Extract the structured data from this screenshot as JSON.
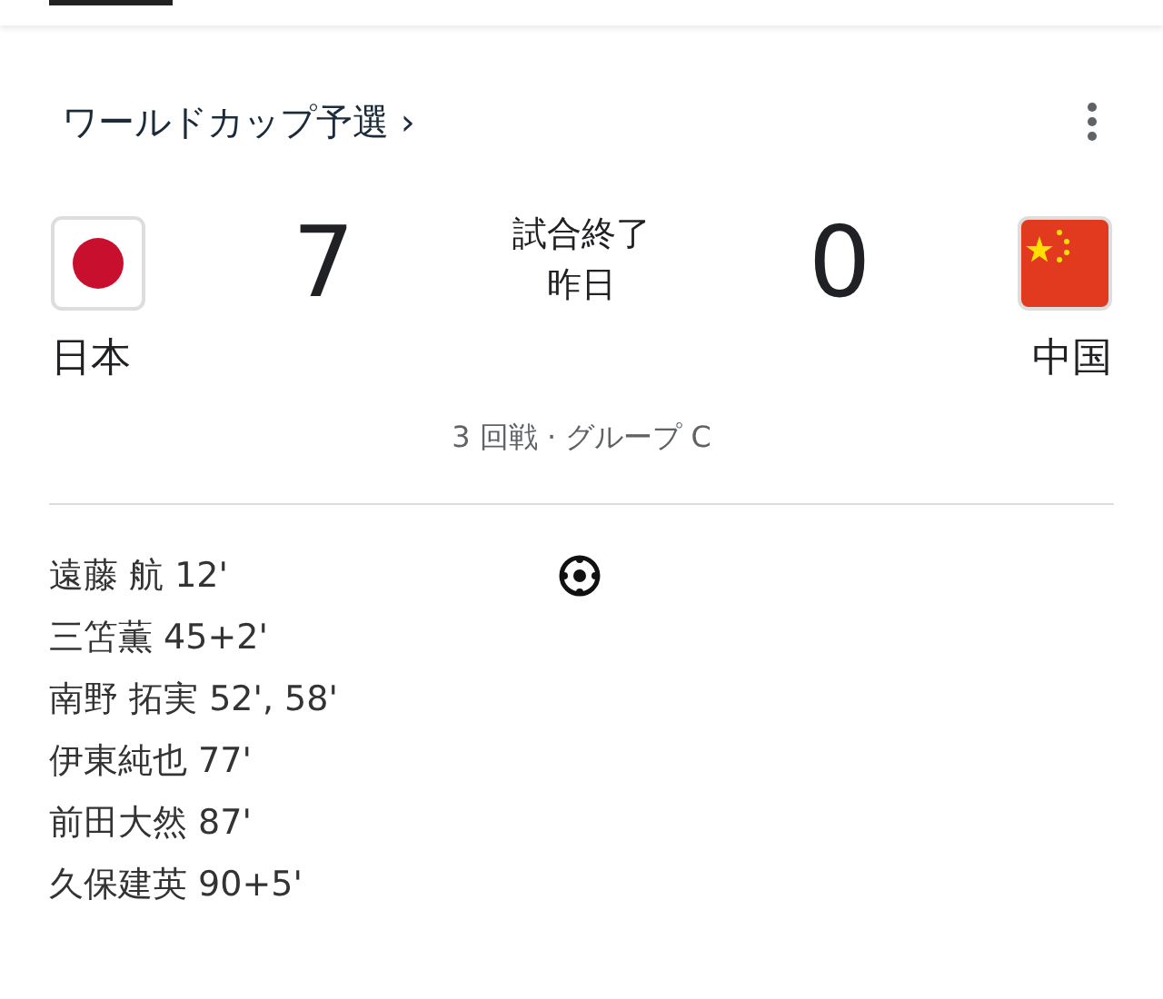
{
  "competition": {
    "label": "ワールドカップ予選 ›"
  },
  "home": {
    "name": "日本",
    "score": "7",
    "kind": "japan"
  },
  "status": {
    "state": "試合終了",
    "date": "昨日"
  },
  "away": {
    "name": "中国",
    "score": "0",
    "kind": "china"
  },
  "round": "3 回戦 · グループ C",
  "scorers": [
    "遠藤 航 12'",
    "三笘薫 45+2'",
    "南野 拓実 52', 58'",
    "伊東純也 77'",
    "前田大然 87'",
    "久保建英 90+5'"
  ]
}
